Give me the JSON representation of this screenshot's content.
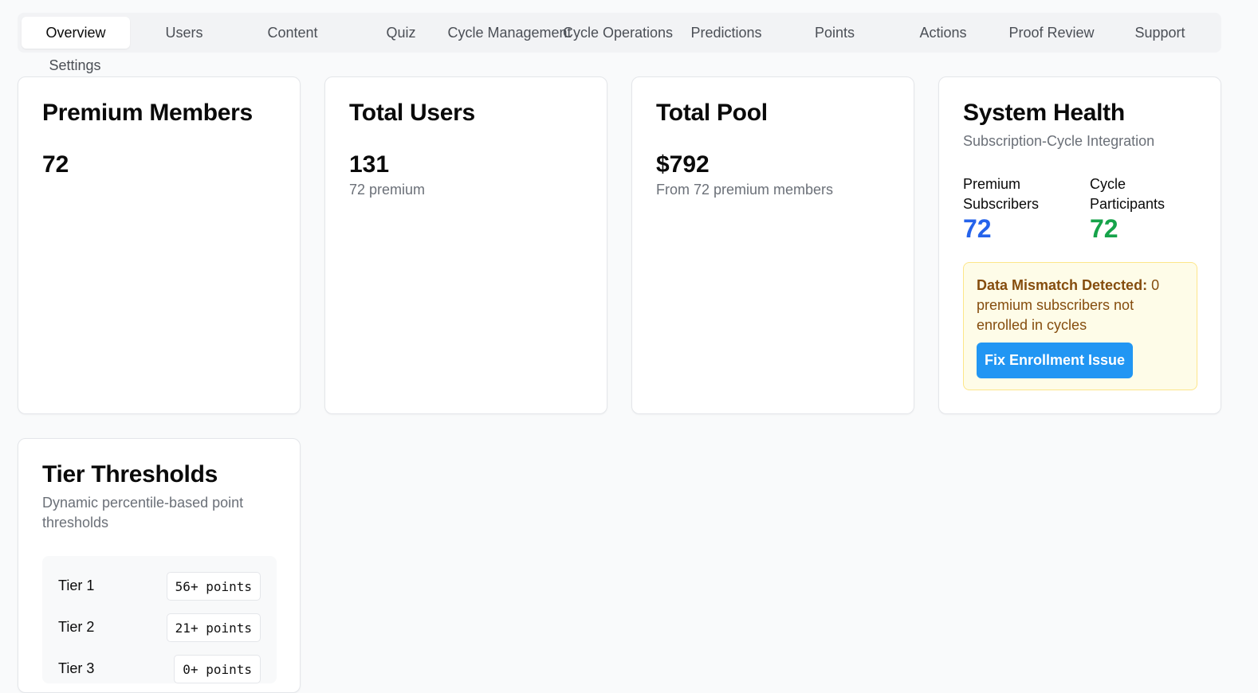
{
  "tabs": [
    {
      "label": "Overview"
    },
    {
      "label": "Users"
    },
    {
      "label": "Content"
    },
    {
      "label": "Quiz"
    },
    {
      "label": "Cycle Management"
    },
    {
      "label": "Cycle Operations"
    },
    {
      "label": "Predictions"
    },
    {
      "label": "Points"
    },
    {
      "label": "Actions"
    },
    {
      "label": "Proof Review"
    },
    {
      "label": "Support"
    },
    {
      "label": "Settings"
    }
  ],
  "active_tab": "Overview",
  "cards": {
    "premium_members": {
      "title": "Premium Members",
      "value": "72"
    },
    "total_users": {
      "title": "Total Users",
      "value": "131",
      "sub": "72 premium"
    },
    "total_pool": {
      "title": "Total Pool",
      "value": "$792",
      "sub": "From 72 premium members"
    },
    "system_health": {
      "title": "System Health",
      "subtitle": "Subscription-Cycle Integration",
      "premium_label": "Premium Subscribers",
      "premium_value": "72",
      "cycle_label": "Cycle Participants",
      "cycle_value": "72",
      "alert_strong": "Data Mismatch Detected:",
      "alert_text": " 0 premium subscribers not enrolled in cycles",
      "fix_button": "Fix Enrollment Issue"
    },
    "tier_thresholds": {
      "title": "Tier Thresholds",
      "subtitle": "Dynamic percentile-based point thresholds",
      "tiers": [
        {
          "name": "Tier 1",
          "points": "56+ points"
        },
        {
          "name": "Tier 2",
          "points": "21+ points"
        },
        {
          "name": "Tier 3",
          "points": "0+ points"
        }
      ]
    }
  },
  "colors": {
    "premium_value": "#2563eb",
    "cycle_value": "#16a34a",
    "button": "#2196f3"
  }
}
